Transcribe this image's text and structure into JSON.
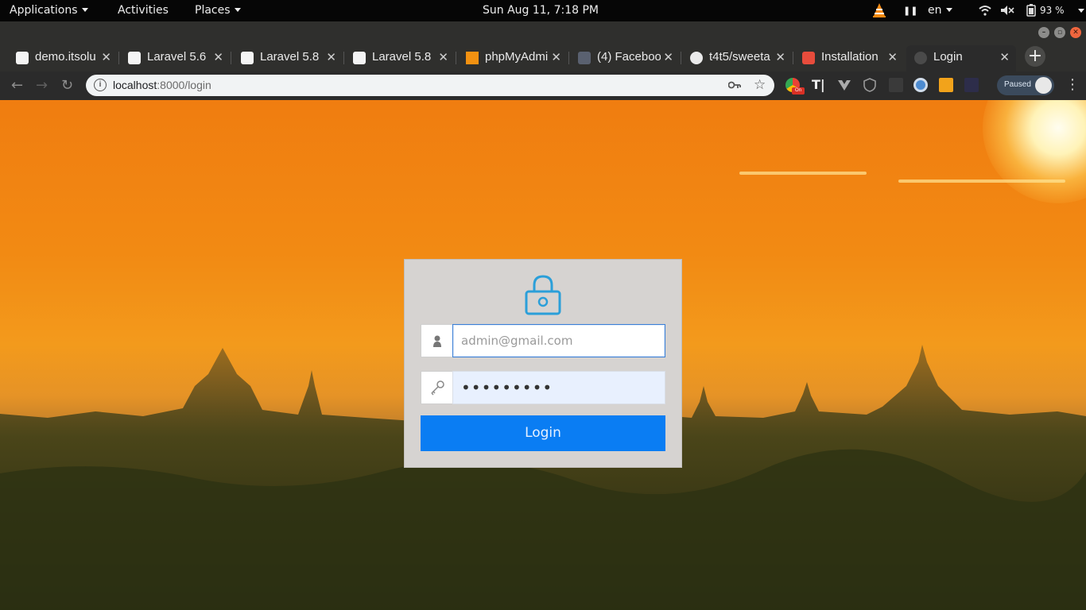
{
  "topbar": {
    "applications": "Applications",
    "activities": "Activities",
    "places": "Places",
    "clock": "Sun Aug 11,  7:18 PM",
    "language": "en",
    "battery": "93 %"
  },
  "tabs": [
    {
      "title": "demo.itsolu",
      "active": false
    },
    {
      "title": "Laravel 5.6",
      "active": false
    },
    {
      "title": "Laravel 5.8",
      "active": false
    },
    {
      "title": "Laravel 5.8",
      "active": false
    },
    {
      "title": "phpMyAdmi",
      "active": false
    },
    {
      "title": "(4) Faceboo",
      "active": false
    },
    {
      "title": "t4t5/sweeta",
      "active": false
    },
    {
      "title": "Installation",
      "active": false
    },
    {
      "title": "Login",
      "active": true
    }
  ],
  "omnibox": {
    "host": "localhost",
    "rest": ":8000/login"
  },
  "profile": {
    "status": "Paused"
  },
  "login": {
    "email_placeholder": "admin@gmail.com",
    "password_value": "•••••••••",
    "button_label": "Login"
  },
  "colors": {
    "accent": "#0a7df3",
    "lock_icon": "#2b9fd9",
    "card": "#d6d3d1"
  }
}
